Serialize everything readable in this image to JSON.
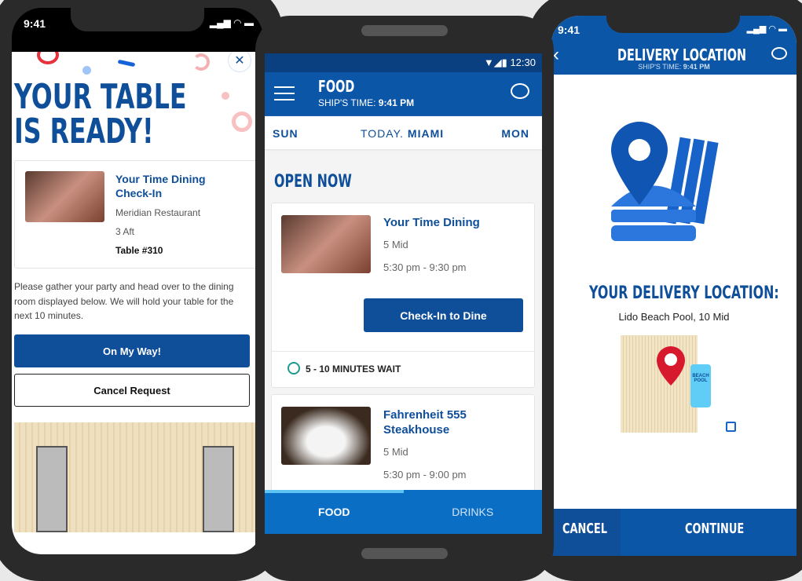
{
  "phone1": {
    "status_time": "9:41",
    "title_line1": "YOUR TABLE",
    "title_line2": "IS READY!",
    "close_icon": "x-icon",
    "card": {
      "title_line1": "Your Time Dining",
      "title_line2": "Check-In",
      "restaurant": "Meridian Restaurant",
      "deck": "3 Aft",
      "table": "Table #310"
    },
    "message": "Please gather your party and head over to the dining room displayed below. We will hold your table for the next 10 minutes.",
    "primary_button": "On My Way!",
    "secondary_button": "Cancel Request"
  },
  "phone2": {
    "status_time": "12:30",
    "header": {
      "title": "FOOD",
      "ships_time_label": "SHIP'S TIME:",
      "ships_time": "9:41 PM"
    },
    "day_nav": {
      "prev": "SUN",
      "today_label": "TODAY.",
      "today_port": "MIAMI",
      "next": "MON"
    },
    "section_title": "OPEN NOW",
    "venues": [
      {
        "name": "Your Time Dining",
        "deck": "5 Mid",
        "hours": "5:30 pm - 9:30 pm",
        "button": "Check-In to Dine",
        "wait": "5 - 10 MINUTES WAIT"
      },
      {
        "name_line1": "Fahrenheit 555",
        "name_line2": "Steakhouse",
        "deck": "5 Mid",
        "hours": "5:30 pm - 9:00 pm"
      }
    ],
    "tabs": [
      {
        "label": "FOOD",
        "active": true
      },
      {
        "label": "DRINKS",
        "active": false
      }
    ]
  },
  "phone3": {
    "status_time": "9:41",
    "header": {
      "title": "DELIVERY LOCATION",
      "ships_time_label": "SHIP'S TIME:",
      "ships_time": "9:41 PM"
    },
    "location_heading": "YOUR DELIVERY LOCATION:",
    "location": "Lido Beach Pool, 10 Mid",
    "map_label": "BEACH POOL",
    "cancel": "CANCEL",
    "continue": "CONTINUE"
  },
  "colors": {
    "brand_blue": "#0f4e99",
    "header_blue": "#0c56a8",
    "tab_blue": "#0a6fc4",
    "pin_red": "#d7192d",
    "pool": "#5fcdf5"
  }
}
